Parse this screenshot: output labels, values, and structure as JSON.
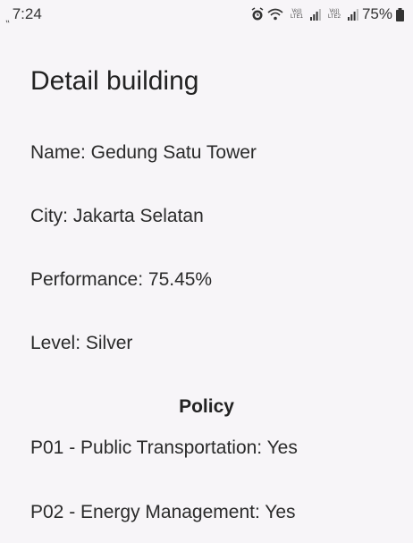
{
  "status_bar": {
    "time": "7:24",
    "network_1": "Vo)) LTE1",
    "network_2": "Vo)) LTE2",
    "battery": "75%"
  },
  "screen": {
    "title": "Detail building",
    "name": "Name: Gedung Satu Tower",
    "city": "City: Jakarta Selatan",
    "performance": "Performance: 75.45%",
    "level": "Level: Silver"
  },
  "policy": {
    "heading": "Policy",
    "items": [
      "P01 - Public Transportation: Yes",
      "P02 - Energy Management: Yes"
    ]
  },
  "colors": {
    "background": "#f7f5f8",
    "text": "#222222"
  }
}
